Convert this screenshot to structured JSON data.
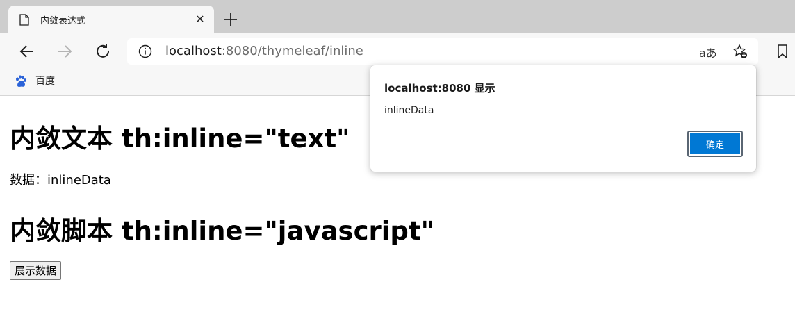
{
  "browser": {
    "tab": {
      "title": "内敛表达式"
    },
    "address_bar": {
      "url_host": "localhost",
      "url_rest": ":8080/thymeleaf/inline"
    },
    "read_aloud_label": "aあ",
    "bookmarks": [
      {
        "label": "百度",
        "icon": "baidu-paw-icon"
      }
    ]
  },
  "page": {
    "heading_text": "内敛文本 th:inline=\"text\"",
    "data_line": "数据：inlineData",
    "heading_script": "内敛脚本 th:inline=\"javascript\"",
    "show_button": "展示数据"
  },
  "alert": {
    "title": "localhost:8080 显示",
    "message": "inlineData",
    "ok_label": "确定",
    "ok_color": "#0078d4"
  },
  "icons": {
    "tab_favicon": "document-icon",
    "tab_close": "close-icon",
    "new_tab": "plus-icon",
    "back": "back-arrow-icon",
    "forward": "forward-arrow-icon",
    "refresh": "refresh-icon",
    "site_info": "info-icon",
    "add_favorite": "star-plus-icon",
    "favorites": "bookmark-icon"
  }
}
